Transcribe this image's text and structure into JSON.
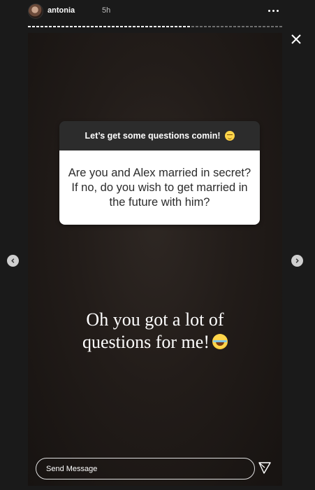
{
  "header": {
    "username": "antonia",
    "time": "5h",
    "avatar_icon": "profile-avatar"
  },
  "progress": {
    "segments": 1,
    "fraction_watched": 0.64
  },
  "story": {
    "question_sticker": {
      "prompt": "Let’s get some questions comin!",
      "prompt_emoji": "smirk-emoji",
      "question": "Are you and Alex married in secret? If no, do you wish to get married in the future with him?"
    },
    "caption": {
      "line1": "Oh you got a lot of",
      "line2": "questions for me!",
      "emoji": "laughing-tears-emoji"
    }
  },
  "footer": {
    "send_placeholder": "Send Message",
    "send_icon": "paper-plane-icon"
  },
  "colors": {
    "background": "#1a1a1a",
    "story_bg": "#221c19",
    "sticker_header": "#2c2c2c",
    "sticker_body": "#ffffff"
  }
}
